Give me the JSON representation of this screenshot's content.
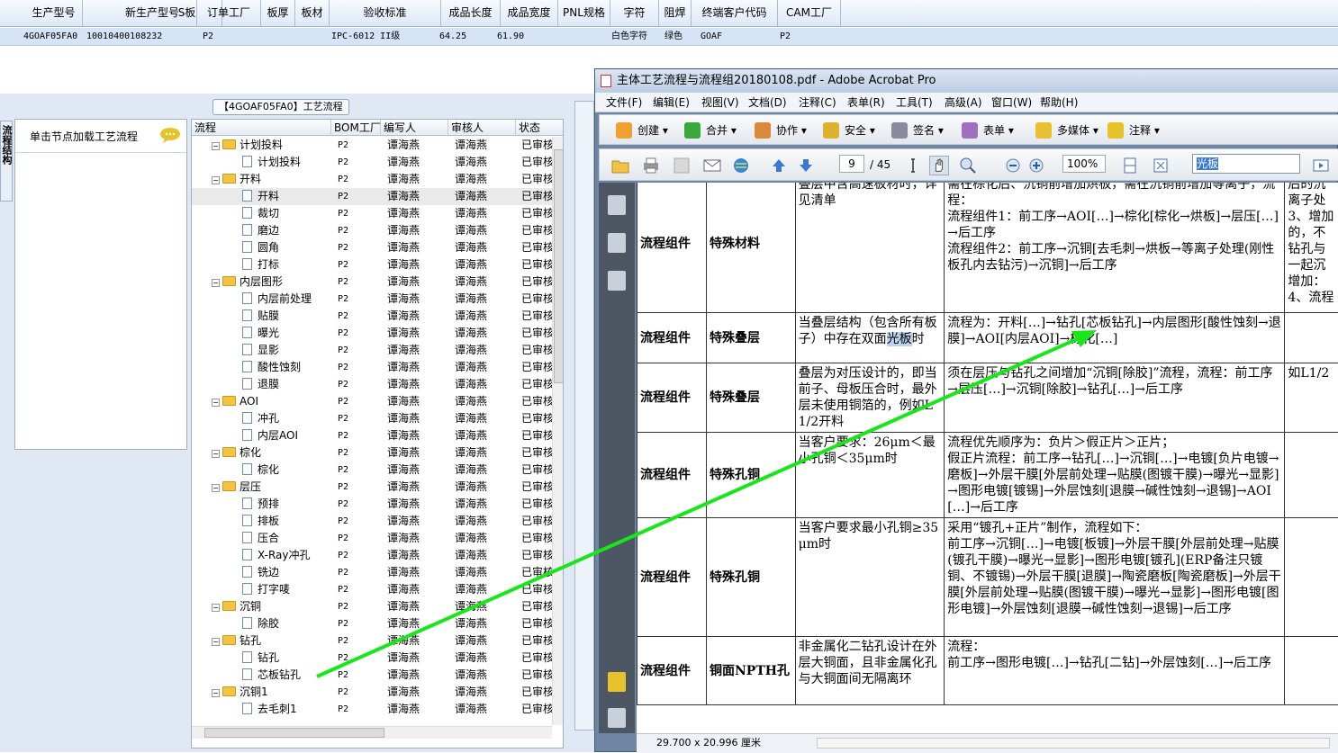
{
  "top_grid": {
    "headers": [
      "生产型号",
      "新生产型号",
      "S板",
      "订单工厂",
      "板厚",
      "板材",
      "验收标准",
      "成品长度",
      "成品宽度",
      "PNL规格",
      "字符",
      "阻焊",
      "终端客户代码",
      "CAM工厂"
    ],
    "row": [
      "4GOAF05FA0",
      "10010400108232",
      "",
      "P2",
      "",
      "",
      "IPC-6012 II级",
      "64.25",
      "61.90",
      "",
      "白色字符",
      "绿色",
      "GOAF",
      "P2"
    ]
  },
  "left_panel": {
    "title": "【4GOAF05FA0】工艺流程",
    "side_tab": "流程结构",
    "node_hint": "单击节点加载工艺流程"
  },
  "tree": {
    "headers": [
      "流程",
      "BOM工厂",
      "编写人",
      "审核人",
      "状态"
    ],
    "rows": [
      {
        "indent": 1,
        "folder": true,
        "label": "计划投料",
        "bom": "P2",
        "writer": "谭海燕",
        "auditor": "谭海燕",
        "status": "已审核"
      },
      {
        "indent": 2,
        "folder": false,
        "label": "计划投料",
        "bom": "P2",
        "writer": "谭海燕",
        "auditor": "谭海燕",
        "status": "已审核"
      },
      {
        "indent": 1,
        "folder": true,
        "label": "开料",
        "bom": "P2",
        "writer": "谭海燕",
        "auditor": "谭海燕",
        "status": "已审核"
      },
      {
        "indent": 2,
        "folder": false,
        "label": "开料",
        "bom": "P2",
        "writer": "谭海燕",
        "auditor": "谭海燕",
        "status": "已审核",
        "selected": true
      },
      {
        "indent": 2,
        "folder": false,
        "label": "裁切",
        "bom": "P2",
        "writer": "谭海燕",
        "auditor": "谭海燕",
        "status": "已审核"
      },
      {
        "indent": 2,
        "folder": false,
        "label": "磨边",
        "bom": "P2",
        "writer": "谭海燕",
        "auditor": "谭海燕",
        "status": "已审核"
      },
      {
        "indent": 2,
        "folder": false,
        "label": "圆角",
        "bom": "P2",
        "writer": "谭海燕",
        "auditor": "谭海燕",
        "status": "已审核"
      },
      {
        "indent": 2,
        "folder": false,
        "label": "打标",
        "bom": "P2",
        "writer": "谭海燕",
        "auditor": "谭海燕",
        "status": "已审核"
      },
      {
        "indent": 1,
        "folder": true,
        "label": "内层图形",
        "bom": "P2",
        "writer": "谭海燕",
        "auditor": "谭海燕",
        "status": "已审核"
      },
      {
        "indent": 2,
        "folder": false,
        "label": "内层前处理",
        "bom": "P2",
        "writer": "谭海燕",
        "auditor": "谭海燕",
        "status": "已审核"
      },
      {
        "indent": 2,
        "folder": false,
        "label": "贴膜",
        "bom": "P2",
        "writer": "谭海燕",
        "auditor": "谭海燕",
        "status": "已审核"
      },
      {
        "indent": 2,
        "folder": false,
        "label": "曝光",
        "bom": "P2",
        "writer": "谭海燕",
        "auditor": "谭海燕",
        "status": "已审核"
      },
      {
        "indent": 2,
        "folder": false,
        "label": "显影",
        "bom": "P2",
        "writer": "谭海燕",
        "auditor": "谭海燕",
        "status": "已审核"
      },
      {
        "indent": 2,
        "folder": false,
        "label": "酸性蚀刻",
        "bom": "P2",
        "writer": "谭海燕",
        "auditor": "谭海燕",
        "status": "已审核"
      },
      {
        "indent": 2,
        "folder": false,
        "label": "退膜",
        "bom": "P2",
        "writer": "谭海燕",
        "auditor": "谭海燕",
        "status": "已审核"
      },
      {
        "indent": 1,
        "folder": true,
        "label": "AOI",
        "bom": "P2",
        "writer": "谭海燕",
        "auditor": "谭海燕",
        "status": "已审核"
      },
      {
        "indent": 2,
        "folder": false,
        "label": "冲孔",
        "bom": "P2",
        "writer": "谭海燕",
        "auditor": "谭海燕",
        "status": "已审核"
      },
      {
        "indent": 2,
        "folder": false,
        "label": "内层AOI",
        "bom": "P2",
        "writer": "谭海燕",
        "auditor": "谭海燕",
        "status": "已审核"
      },
      {
        "indent": 1,
        "folder": true,
        "label": "棕化",
        "bom": "P2",
        "writer": "谭海燕",
        "auditor": "谭海燕",
        "status": "已审核"
      },
      {
        "indent": 2,
        "folder": false,
        "label": "棕化",
        "bom": "P2",
        "writer": "谭海燕",
        "auditor": "谭海燕",
        "status": "已审核"
      },
      {
        "indent": 1,
        "folder": true,
        "label": "层压",
        "bom": "P2",
        "writer": "谭海燕",
        "auditor": "谭海燕",
        "status": "已审核"
      },
      {
        "indent": 2,
        "folder": false,
        "label": "预排",
        "bom": "P2",
        "writer": "谭海燕",
        "auditor": "谭海燕",
        "status": "已审核"
      },
      {
        "indent": 2,
        "folder": false,
        "label": "排板",
        "bom": "P2",
        "writer": "谭海燕",
        "auditor": "谭海燕",
        "status": "已审核"
      },
      {
        "indent": 2,
        "folder": false,
        "label": "压合",
        "bom": "P2",
        "writer": "谭海燕",
        "auditor": "谭海燕",
        "status": "已审核"
      },
      {
        "indent": 2,
        "folder": false,
        "label": "X-Ray冲孔",
        "bom": "P2",
        "writer": "谭海燕",
        "auditor": "谭海燕",
        "status": "已审核"
      },
      {
        "indent": 2,
        "folder": false,
        "label": "铣边",
        "bom": "P2",
        "writer": "谭海燕",
        "auditor": "谭海燕",
        "status": "已审核"
      },
      {
        "indent": 2,
        "folder": false,
        "label": "打字唛",
        "bom": "P2",
        "writer": "谭海燕",
        "auditor": "谭海燕",
        "status": "已审核"
      },
      {
        "indent": 1,
        "folder": true,
        "label": "沉铜",
        "bom": "P2",
        "writer": "谭海燕",
        "auditor": "谭海燕",
        "status": "已审核"
      },
      {
        "indent": 2,
        "folder": false,
        "label": "除胶",
        "bom": "P2",
        "writer": "谭海燕",
        "auditor": "谭海燕",
        "status": "已审核"
      },
      {
        "indent": 1,
        "folder": true,
        "label": "钻孔",
        "bom": "P2",
        "writer": "谭海燕",
        "auditor": "谭海燕",
        "status": "已审核"
      },
      {
        "indent": 2,
        "folder": false,
        "label": "钻孔",
        "bom": "P2",
        "writer": "谭海燕",
        "auditor": "谭海燕",
        "status": "已审核"
      },
      {
        "indent": 2,
        "folder": false,
        "label": "芯板钻孔",
        "bom": "P2",
        "writer": "谭海燕",
        "auditor": "谭海燕",
        "status": "已审核"
      },
      {
        "indent": 1,
        "folder": true,
        "label": "沉铜1",
        "bom": "P2",
        "writer": "谭海燕",
        "auditor": "谭海燕",
        "status": "已审核"
      },
      {
        "indent": 2,
        "folder": false,
        "label": "去毛刺1",
        "bom": "P2",
        "writer": "谭海燕",
        "auditor": "谭海燕",
        "status": "已审核"
      }
    ]
  },
  "acrobat": {
    "title": "主体工艺流程与流程组20180108.pdf - Adobe Acrobat Pro",
    "menu": [
      "文件(F)",
      "编辑(E)",
      "视图(V)",
      "文档(D)",
      "注释(C)",
      "表单(R)",
      "工具(T)",
      "高级(A)",
      "窗口(W)",
      "帮助(H)"
    ],
    "toolbar1": [
      "创建",
      "合并",
      "协作",
      "安全",
      "签名",
      "表单",
      "多媒体",
      "注释"
    ],
    "page_current": "9",
    "page_total": "/ 45",
    "zoom": "100%",
    "find_text": "光板",
    "status_dims": "29.700 x 20.996 厘米",
    "table_rows": [
      {
        "c1": "流程组件",
        "c2": "特殊材料",
        "c3": "叠层中含高速板材时，详见清单",
        "c4": "需在棕化后、沉铜前增加烘板，需在沉铜前增加等离子，流程：\n流程组件1：前工序→AOI[…]→棕化[棕化→烘板]→层压[…]→后工序\n流程组件2：前工序→沉铜[去毛刺→烘板→等离子处理(刚性板孔内去钻污)→沉铜]→后工序",
        "c5": "后的沉离子处3、增加的，不钻孔与一起沉增加：4、流程"
      },
      {
        "c1": "流程组件",
        "c2": "特殊叠层",
        "c3_pre": "当叠层结构（包含所有板子）中存在双面",
        "c3_hl": "光板",
        "c3_post": "时",
        "c4": "流程为：开料[…]→钻孔[芯板钻孔]→内层图形[酸性蚀刻→退膜]→AOI[内层AOI]→棕化[…]",
        "c5": ""
      },
      {
        "c1": "流程组件",
        "c2": "特殊叠层",
        "c3": "叠层为对压设计的，即当前子、母板压合时，最外层未使用铜箔的，例如L1/2开料",
        "c4": "须在层压与钻孔之间增加“沉铜[除胶]”流程，流程：前工序→层压[…]→沉铜[除胶]→钻孔[…]→后工序",
        "c5": "如L1/2"
      },
      {
        "c1": "流程组件",
        "c2": "特殊孔铜",
        "c3": "当客户要求：26μm＜最小孔铜＜35μm时",
        "c4": "流程优先顺序为：负片＞假正片＞正片；\n假正片流程：前工序→钻孔[…]→沉铜[…]→电镀[负片电镀→磨板]→外层干膜[外层前处理→贴膜(图镀干膜)→曝光→显影]→图形电镀[镀锡]→外层蚀刻[退膜→碱性蚀刻→退锡]→AOI[…]→后工序",
        "c5": ""
      },
      {
        "c1": "流程组件",
        "c2": "特殊孔铜",
        "c3": "当客户要求最小孔铜≥35μm时",
        "c4": "采用“镀孔+正片”制作，流程如下：\n前工序→沉铜[…]→电镀[板镀]→外层干膜[外层前处理→贴膜(镀孔干膜)→曝光→显影]→图形电镀[镀孔](ERP备注只镀铜、不镀锡)→外层干膜[退膜]→陶瓷磨板[陶瓷磨板]→外层干膜[外层前处理→贴膜(图镀干膜)→曝光→显影]→图形电镀[图形电镀]→外层蚀刻[退膜→碱性蚀刻→退锡]→后工序",
        "c5": ""
      },
      {
        "c1": "流程组件",
        "c2": "铜面NPTH孔",
        "c3": "非金属化二钻孔设计在外层大铜面，且非金属化孔与大铜面间无隔离环",
        "c4": "流程：\n前工序→图形电镀[…]→钻孔[二钻]→外层蚀刻[…]→后工序",
        "c5": ""
      }
    ]
  },
  "colors": {
    "arrow": "#19e619",
    "header_bg": "#dde8f5",
    "selected_row": "#d6e4f7"
  }
}
